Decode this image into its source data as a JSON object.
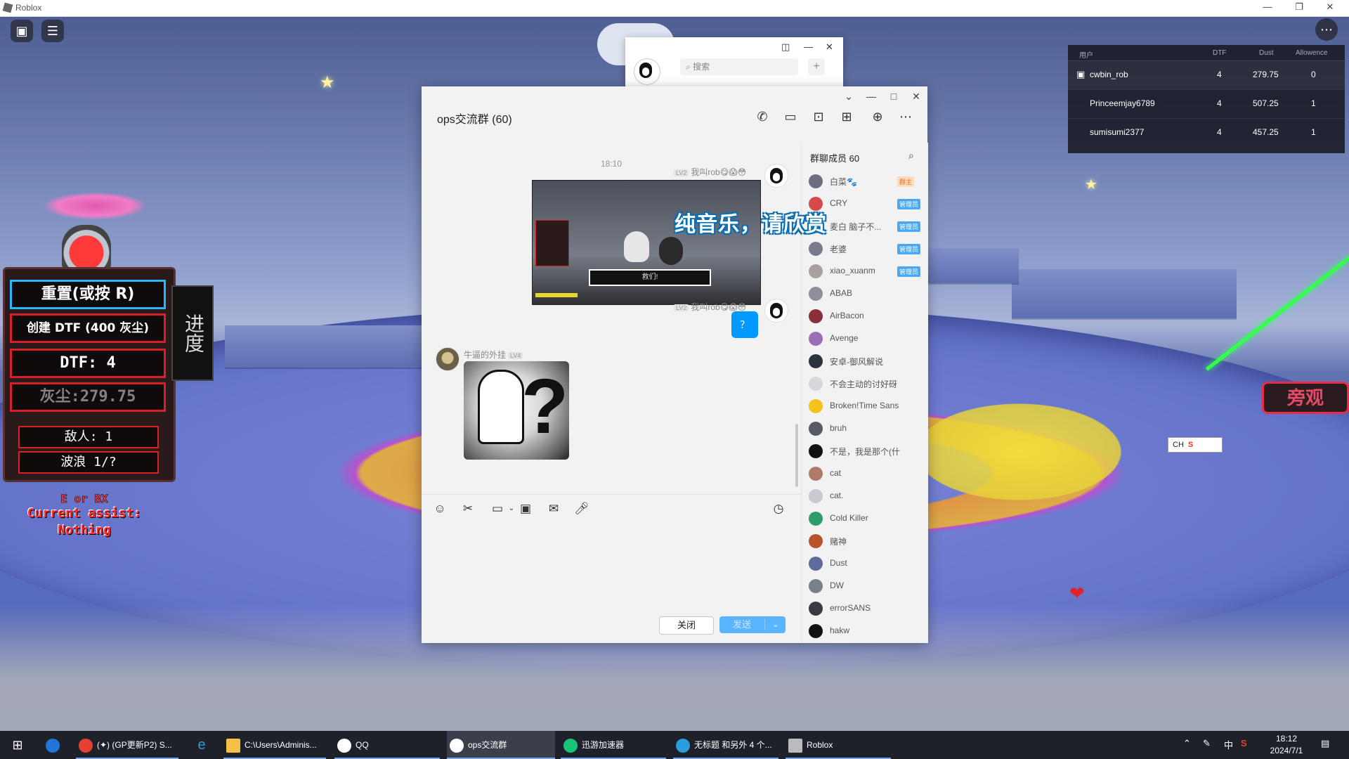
{
  "roblox": {
    "window_title": "Roblox",
    "hud": {
      "reset_label": "重置(或按 R)",
      "create_label": "创建 DTF (400 灰尘)",
      "dtf_label": "DTF: 4",
      "dust_label": "灰尘:279.75",
      "enemy_label": "敌人: 1",
      "wave_label": "波浪 1/?",
      "side_label": "进度",
      "ex_label": "E or BX",
      "assist_label": "Current assist:",
      "assist_value": "Nothing"
    },
    "spectate_label": "旁观",
    "ime": {
      "lang": "CH",
      "icon": "S"
    },
    "leaderboard": {
      "headers": [
        "用户",
        "DTF",
        "Dust",
        "Allowence"
      ],
      "rows": [
        {
          "name": "cwbin_rob",
          "dtf": "4",
          "dust": "279.75",
          "allowence": "0"
        },
        {
          "name": "Princeemjay6789",
          "dtf": "4",
          "dust": "507.25",
          "allowence": "1"
        },
        {
          "name": "sumisumi2377",
          "dtf": "4",
          "dust": "457.25",
          "allowence": "1"
        }
      ]
    }
  },
  "qq_mini": {
    "search_placeholder": "搜索"
  },
  "chat": {
    "title": "ops交流群 (60)",
    "timestamp": "18:10",
    "messages": [
      {
        "sender": "我叫rob😋😱😳",
        "level": "LV2",
        "type": "image",
        "image_caption": "救们!"
      },
      {
        "sender": "我叫rob😋😱😳",
        "level": "LV2",
        "type": "text",
        "text": "？"
      },
      {
        "sender": "牛逼的外挂",
        "level": "LV4",
        "type": "image"
      }
    ],
    "subtitle_overlay": "纯音乐，请欣赏",
    "close_button": "关闭",
    "send_button": "发送",
    "members_title": "群聊成员 60",
    "members": [
      {
        "name": "白菜🐾",
        "badge": "群主",
        "color": "#6b6f80"
      },
      {
        "name": "CRY",
        "badge": "管理员",
        "color": "#d74a4a"
      },
      {
        "name": "麦白 脑子不...",
        "badge": "管理员",
        "color": "#9aa0b0"
      },
      {
        "name": "老婆",
        "badge": "管理员",
        "color": "#777b8c"
      },
      {
        "name": "xiao_xuanm",
        "badge": "管理员",
        "color": "#a9a0a0"
      },
      {
        "name": "ABAB",
        "badge": "",
        "color": "#8f8f9a"
      },
      {
        "name": "AirBacon",
        "badge": "",
        "color": "#8a2f3a"
      },
      {
        "name": "Avenge",
        "badge": "",
        "color": "#9a6fb8"
      },
      {
        "name": "安卓-御风解说",
        "badge": "",
        "color": "#2d3240"
      },
      {
        "name": "不会主动的讨好砑",
        "badge": "",
        "color": "#d8d8dc"
      },
      {
        "name": "Broken!Time Sans",
        "badge": "",
        "color": "#f3c21b"
      },
      {
        "name": "bruh",
        "badge": "",
        "color": "#555a66"
      },
      {
        "name": "不是，我是那个(什么...",
        "badge": "",
        "color": "#111111"
      },
      {
        "name": "cat",
        "badge": "",
        "color": "#b07a6a"
      },
      {
        "name": "cat.",
        "badge": "",
        "color": "#c9c9cf"
      },
      {
        "name": "Cold Killer",
        "badge": "",
        "color": "#2f9d6a"
      },
      {
        "name": "赌神",
        "badge": "",
        "color": "#b8542c"
      },
      {
        "name": "Dust",
        "badge": "",
        "color": "#5d6a9a"
      },
      {
        "name": "DW",
        "badge": "",
        "color": "#7a7f8c"
      },
      {
        "name": "errorSANS",
        "badge": "",
        "color": "#3a3a44"
      },
      {
        "name": "hakw",
        "badge": "",
        "color": "#111111"
      }
    ]
  },
  "taskbar": {
    "items": [
      {
        "label": "(✦) (GP更新P2) S...",
        "color": "#e44134"
      },
      {
        "label": "C:\\Users\\Adminis...",
        "color": "#f2c145"
      },
      {
        "label": "QQ",
        "color": "#ffffff"
      },
      {
        "label": "ops交流群",
        "color": "#ffffff"
      },
      {
        "label": "迅游加速器",
        "color": "#18c47a"
      },
      {
        "label": "无标题 和另外 4 个...",
        "color": "#2c9be0"
      },
      {
        "label": "Roblox",
        "color": "#bbbbbb"
      }
    ],
    "tray_ime": "中",
    "time": "18:12",
    "date": "2024/7/1"
  }
}
